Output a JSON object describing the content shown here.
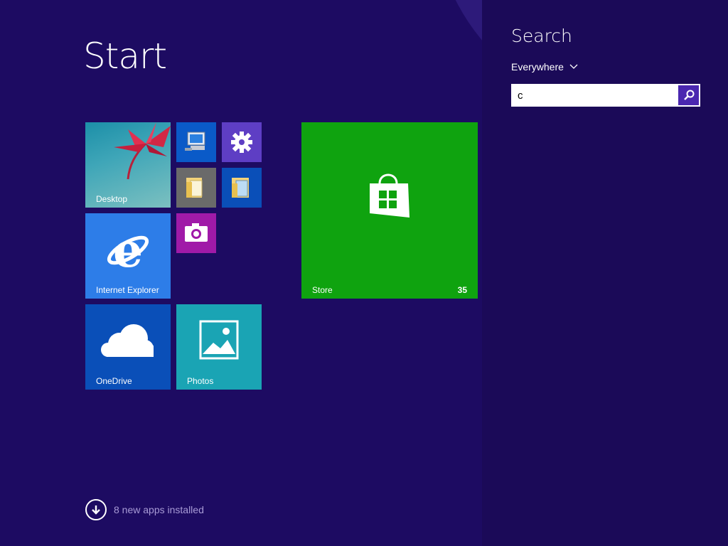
{
  "start": {
    "title": "Start",
    "new_apps": "8 new apps installed"
  },
  "tiles": {
    "desktop": "Desktop",
    "ie": "Internet Explorer",
    "onedrive": "OneDrive",
    "photos": "Photos",
    "store": "Store",
    "store_badge": "35"
  },
  "search": {
    "title": "Search",
    "scope": "Everywhere",
    "value": "c"
  },
  "colors": {
    "start_bg": "#1d0b62",
    "store_tile": "#0fa30f",
    "ie_tile": "#2d7de8",
    "onedrive_tile": "#0a4fb8",
    "photos_tile": "#1aa4b4",
    "settings_tile": "#5e3ec4",
    "camera_tile": "#a01aa8",
    "search_button": "#4a27b0"
  }
}
